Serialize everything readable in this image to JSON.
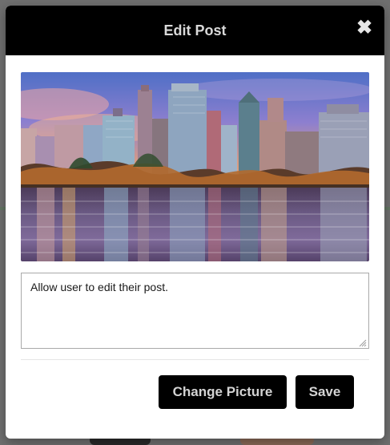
{
  "modal": {
    "title": "Edit Post",
    "close_symbol": "✖",
    "image_alt": "City skyline at sunset reflected in water",
    "post_text": "Allow user to edit their post.",
    "buttons": {
      "change_picture_label": "Change Picture",
      "save_label": "Save"
    }
  },
  "colors": {
    "header_bg": "#000000",
    "button_bg": "#000000",
    "title_text": "#d9d9d9",
    "overlay": "#707070"
  },
  "icons": {
    "close": "close-icon",
    "resize": "resize-handle-icon"
  }
}
